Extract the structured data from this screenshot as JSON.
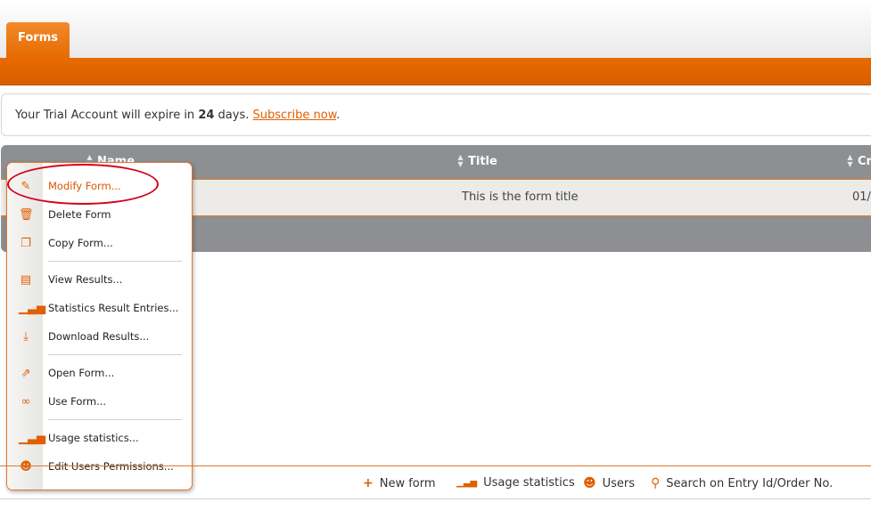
{
  "tabs": [
    {
      "label": "Forms"
    }
  ],
  "notice": {
    "prefix": "Your Trial Account will expire in ",
    "days": "24",
    "suffix": " days. ",
    "link": "Subscribe now",
    "end": "."
  },
  "table": {
    "columns": [
      "Name",
      "Title",
      "Cr"
    ],
    "rows": [
      {
        "title": "This is the form title",
        "created": "01/"
      }
    ]
  },
  "context_menu": {
    "groups": [
      [
        {
          "label": "Modify Form...",
          "icon": "pencil-icon"
        },
        {
          "label": "Delete Form",
          "icon": "trash-icon"
        },
        {
          "label": "Copy Form...",
          "icon": "copy-icon"
        }
      ],
      [
        {
          "label": "View Results...",
          "icon": "results-icon"
        },
        {
          "label": "Statistics Result Entries...",
          "icon": "bar-chart-icon"
        },
        {
          "label": "Download Results...",
          "icon": "download-icon"
        }
      ],
      [
        {
          "label": "Open Form...",
          "icon": "open-external-icon"
        },
        {
          "label": "Use Form...",
          "icon": "link-icon"
        }
      ],
      [
        {
          "label": "Usage statistics...",
          "icon": "bar-chart-icon"
        },
        {
          "label": "Edit Users Permissions...",
          "icon": "user-icon"
        }
      ]
    ]
  },
  "footer": {
    "new_form": "New form",
    "usage_statistics": "Usage statistics",
    "users": "Users",
    "search": "Search on Entry Id/Order No."
  },
  "colors": {
    "accent": "#e56a00",
    "highlight": "#d3001a",
    "grid": "#8e8f93"
  }
}
